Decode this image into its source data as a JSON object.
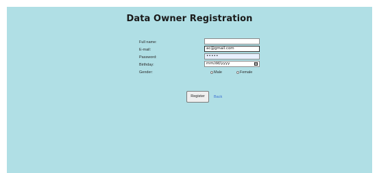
{
  "page": {
    "title": "Data Owner Registration"
  },
  "form": {
    "full_name": {
      "label": "Full name:",
      "value": ""
    },
    "email": {
      "label": "E-mail:",
      "value": "ac@gmail.com"
    },
    "password": {
      "label": "Password:",
      "value": "•••••"
    },
    "birthday": {
      "label": "Birthday:",
      "placeholder": "mm/dd/yyyy"
    },
    "gender": {
      "label": "Gender:",
      "options": [
        "Male",
        "Female"
      ]
    }
  },
  "actions": {
    "register_label": "Register",
    "back_label": "Back"
  },
  "colors": {
    "background": "#b0dfe5",
    "link": "#3b6fd1"
  }
}
